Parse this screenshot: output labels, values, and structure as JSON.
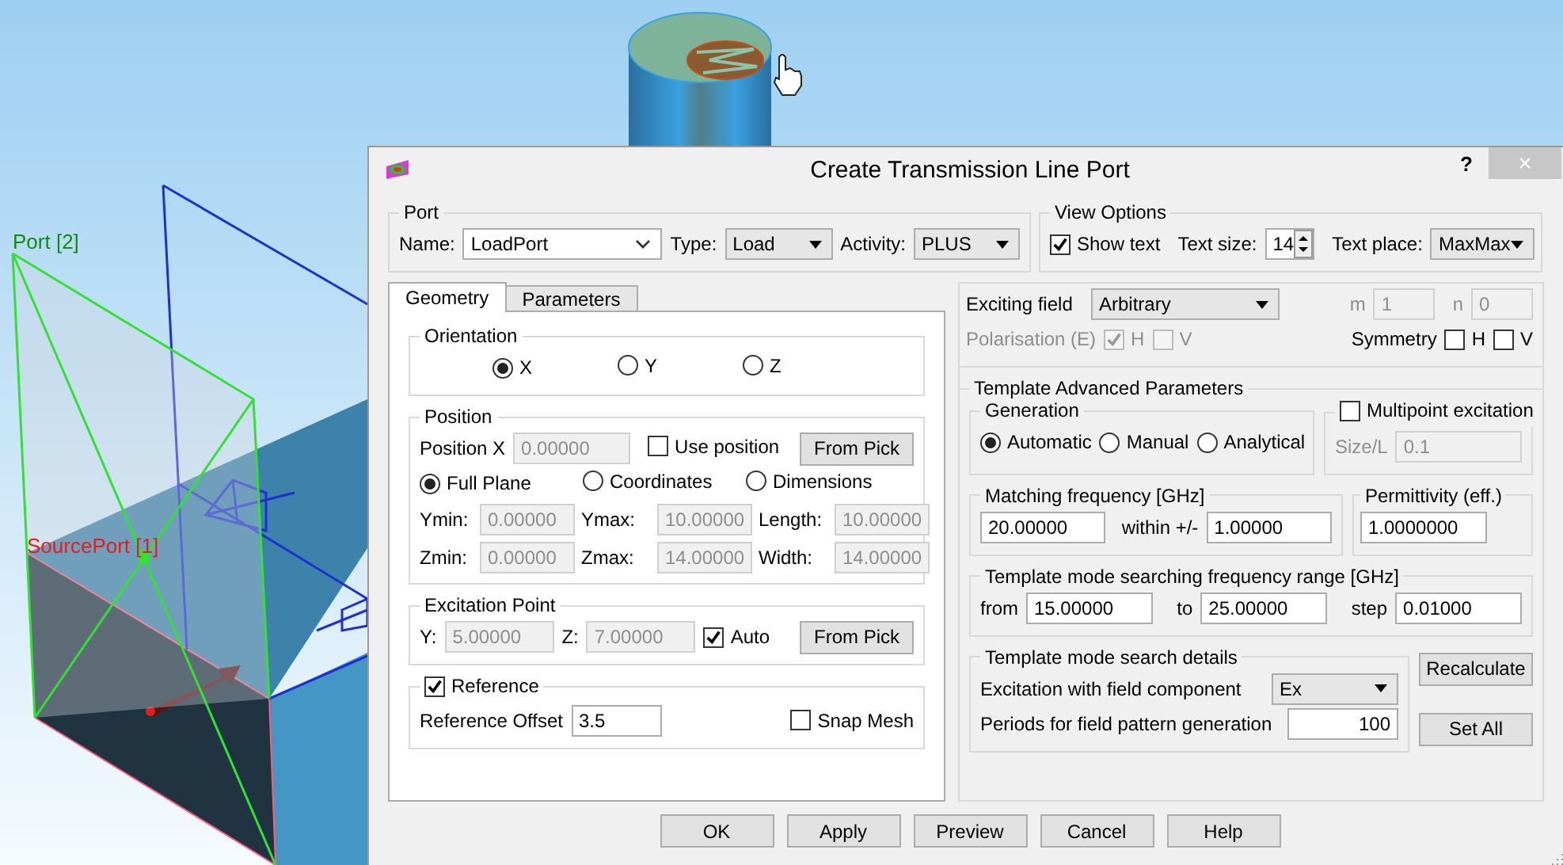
{
  "viewport": {
    "labels": [
      {
        "text": "Port [2]",
        "color": "#138a13"
      },
      {
        "text": "SourcePort [1]",
        "color": "#e02020"
      }
    ]
  },
  "window": {
    "title": "Create Transmission Line Port",
    "help": "?",
    "close": "×"
  },
  "port": {
    "title": "Port",
    "name_label": "Name:",
    "name": "LoadPort",
    "type_label": "Type:",
    "type": "Load",
    "activity_label": "Activity:",
    "activity": "PLUS"
  },
  "view_options": {
    "title": "View Options",
    "show_text": {
      "label": "Show text",
      "checked": true
    },
    "text_size_label": "Text size:",
    "text_size": "14",
    "text_place_label": "Text place:",
    "text_place": "MaxMax"
  },
  "tabs": [
    {
      "label": "Geometry",
      "selected": true
    },
    {
      "label": "Parameters",
      "selected": false
    }
  ],
  "orientation": {
    "title": "Orientation",
    "options": [
      {
        "label": "X",
        "selected": true
      },
      {
        "label": "Y",
        "selected": false
      },
      {
        "label": "Z",
        "selected": false
      }
    ]
  },
  "position": {
    "title": "Position",
    "x_label": "Position X",
    "x": {
      "value": "0.00000",
      "disabled": true
    },
    "use_position": {
      "label": "Use position",
      "checked": false
    },
    "from_pick": "From Pick",
    "modes": [
      {
        "label": "Full Plane",
        "selected": true
      },
      {
        "label": "Coordinates",
        "selected": false
      },
      {
        "label": "Dimensions",
        "selected": false
      }
    ],
    "fields": [
      {
        "label": "Ymin:",
        "value": "0.00000",
        "disabled": true
      },
      {
        "label": "Ymax:",
        "value": "10.00000",
        "disabled": true
      },
      {
        "label": "Length:",
        "value": "10.00000",
        "disabled": true
      },
      {
        "label": "Zmin:",
        "value": "0.00000",
        "disabled": true
      },
      {
        "label": "Zmax:",
        "value": "14.00000",
        "disabled": true
      },
      {
        "label": "Width:",
        "value": "14.00000",
        "disabled": true
      }
    ]
  },
  "excitation_point": {
    "title": "Excitation Point",
    "fields": [
      {
        "label": "Y:",
        "value": "5.00000",
        "disabled": true
      },
      {
        "label": "Z:",
        "value": "7.00000",
        "disabled": true
      }
    ],
    "auto": {
      "label": "Auto",
      "checked": true
    },
    "from_pick": "From Pick"
  },
  "reference": {
    "label": "Reference",
    "checked": true,
    "offset_label": "Reference Offset",
    "offset": {
      "value": "3.5",
      "disabled": false
    },
    "snap_mesh": {
      "label": "Snap Mesh",
      "checked": false
    }
  },
  "exciting": {
    "label": "Exciting field",
    "value": "Arbitrary",
    "m_label": "m",
    "m": {
      "value": "1",
      "disabled": true
    },
    "n_label": "n",
    "n": {
      "value": "0",
      "disabled": true
    },
    "polarisation_label": "Polarisation (E)",
    "polarisation": [
      {
        "label": "H",
        "checked": true,
        "disabled": true
      },
      {
        "label": "V",
        "checked": false,
        "disabled": true
      }
    ],
    "symmetry_label": "Symmetry",
    "symmetry": [
      {
        "label": "H",
        "checked": false,
        "disabled": false
      },
      {
        "label": "V",
        "checked": false,
        "disabled": false
      }
    ]
  },
  "template": {
    "title": "Template Advanced Parameters",
    "generation": {
      "title": "Generation",
      "options": [
        {
          "label": "Automatic",
          "selected": true
        },
        {
          "label": "Manual",
          "selected": false
        },
        {
          "label": "Analytical",
          "selected": false
        }
      ]
    },
    "multipoint": {
      "label": "Multipoint excitation",
      "checked": false,
      "size_label": "Size/L",
      "size": {
        "value": "0.1",
        "disabled": true
      }
    },
    "matching": {
      "title": "Matching frequency [GHz]",
      "value": {
        "value": "20.00000",
        "disabled": false
      },
      "within_label": "within +/-",
      "within": {
        "value": "1.00000",
        "disabled": false
      }
    },
    "permittivity": {
      "title": "Permittivity (eff.)",
      "value": {
        "value": "1.0000000",
        "disabled": false
      }
    },
    "range": {
      "title": "Template mode searching frequency range [GHz]",
      "from_label": "from",
      "from": {
        "value": "15.00000",
        "disabled": false
      },
      "to_label": "to",
      "to": {
        "value": "25.00000",
        "disabled": false
      },
      "step_label": "step",
      "step": {
        "value": "0.01000",
        "disabled": false
      }
    },
    "details": {
      "title": "Template mode search details",
      "component_label": "Excitation with field component",
      "component": "Ex",
      "periods_label": "Periods for field pattern generation",
      "periods": {
        "value": "100",
        "disabled": false
      }
    },
    "recalculate": "Recalculate",
    "set_all": "Set All"
  },
  "buttons": [
    "OK",
    "Apply",
    "Preview",
    "Cancel",
    "Help"
  ]
}
